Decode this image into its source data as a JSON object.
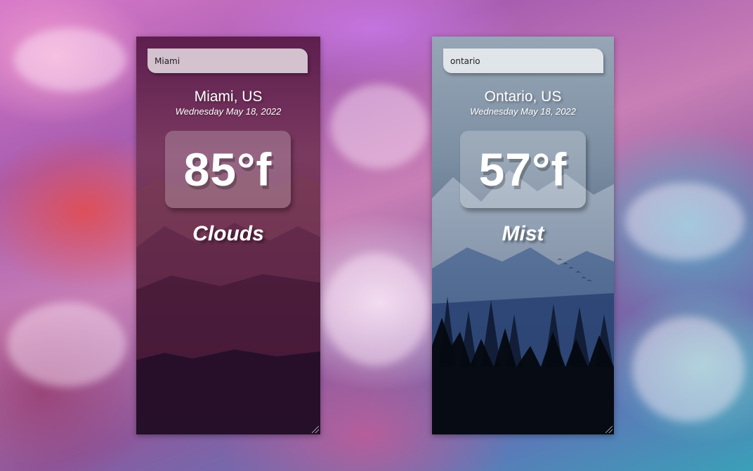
{
  "cards": [
    {
      "search_value": "Miami",
      "location": "Miami, US",
      "date": "Wednesday May 18, 2022",
      "temperature": "85°f",
      "condition": "Clouds"
    },
    {
      "search_value": "ontario",
      "location": "Ontario, US",
      "date": "Wednesday May 18, 2022",
      "temperature": "57°f",
      "condition": "Mist"
    }
  ],
  "colors": {
    "miami_card_top": "#5e1e4f",
    "miami_card_bottom": "#120a1f",
    "ontario_card_top": "#96a6b6",
    "ontario_card_bottom": "#0a0f18",
    "text": "#ffffff"
  },
  "icons": [
    "resize-grip-icon",
    "birds-icon"
  ]
}
